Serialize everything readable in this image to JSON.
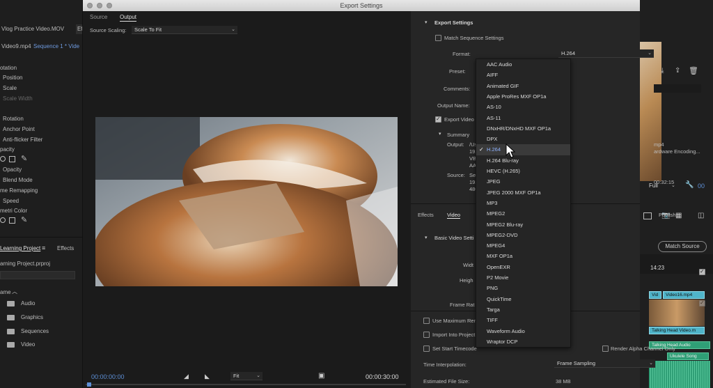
{
  "left_panel": {
    "clip_name": "Vlog Practice Video.MOV",
    "effects_tab": "Eff",
    "sequence_clip": "Video9.mp4",
    "sequence_name": "Sequence 1 * Vide",
    "props": [
      "otation",
      "Position",
      "Scale",
      "Scale Width",
      "Rotation",
      "Anchor Point",
      "Anti-flicker Filter",
      "pacity",
      "Opacity",
      "Blend Mode",
      "me Remapping",
      "Speed",
      "metri Color"
    ],
    "project_tab": "Learning Project",
    "effects_tab2": "Effects",
    "project_file": "arning Project.prproj",
    "col_name": "ame",
    "bins": [
      "Audio",
      "Graphics",
      "Sequences",
      "Video"
    ]
  },
  "dialog": {
    "title": "Export Settings",
    "tabs": [
      "Source",
      "Output"
    ],
    "source_scaling_label": "Source Scaling:",
    "source_scaling_value": "Scale To Fit",
    "timecode_start": "00:00:00:00",
    "timecode_end": "00:00:30:00",
    "fit_value": "Fit"
  },
  "settings": {
    "section_title": "Export Settings",
    "match_sequence": "Match Sequence Settings",
    "format_label": "Format:",
    "format_value": "H.264",
    "preset_label": "Preset:",
    "comments_label": "Comments:",
    "output_name_label": "Output Name:",
    "export_video": "Export Video",
    "summary": "Summary",
    "output_label": "Output:",
    "output_lines": [
      "/Us",
      "192",
      "VBR",
      "AAC"
    ],
    "output_suffix": "mp4",
    "hw_encoding": "ardware Encoding...",
    "source_label": "Source:",
    "source_lines": [
      "Seq",
      "192",
      "480"
    ],
    "source_time": "00:32:15",
    "tabs": [
      "Effects",
      "Video",
      "Publish"
    ],
    "basic_video": "Basic Video Setti",
    "match_source": "Match Source",
    "width_label": "Widt",
    "height_label": "Heigh",
    "frame_rate_label": "Frame Rat",
    "use_max": "Use Maximum Ren",
    "import_into": "Import Into Project",
    "set_start": "Set Start Timecode",
    "render_alpha": "Render Alpha Channel Only",
    "time_interp_label": "Time Interpolation:",
    "time_interp_value": "Frame Sampling",
    "est_size_label": "Estimated File Size:",
    "est_size_value": "38 MB"
  },
  "format_menu": {
    "items": [
      "AAC Audio",
      "AIFF",
      "Animated GIF",
      "Apple ProRes MXF OP1a",
      "AS-10",
      "AS-11",
      "DNxHR/DNxHD MXF OP1a",
      "DPX",
      "H.264",
      "H.264 Blu-ray",
      "HEVC (H.265)",
      "JPEG",
      "JPEG 2000 MXF OP1a",
      "MP3",
      "MPEG2",
      "MPEG2 Blu-ray",
      "MPEG2-DVD",
      "MPEG4",
      "MXF OP1a",
      "OpenEXR",
      "P2 Movie",
      "PNG",
      "QuickTime",
      "Targa",
      "TIFF",
      "Waveform Audio",
      "Wraptor DCP"
    ],
    "selected_index": 8
  },
  "right_panel": {
    "zoom": "Full",
    "timecode": "00",
    "ruler_time": "14:23",
    "clips": [
      "Vid",
      "Video16.mp4",
      "Talking Head Video.m",
      "Talking Head Audio",
      "Ukulele Song"
    ]
  },
  "colors": {
    "clip_green": "#2f9f76",
    "clip_teal": "#4fb4c9",
    "timecode_blue": "#5e8fd6"
  }
}
